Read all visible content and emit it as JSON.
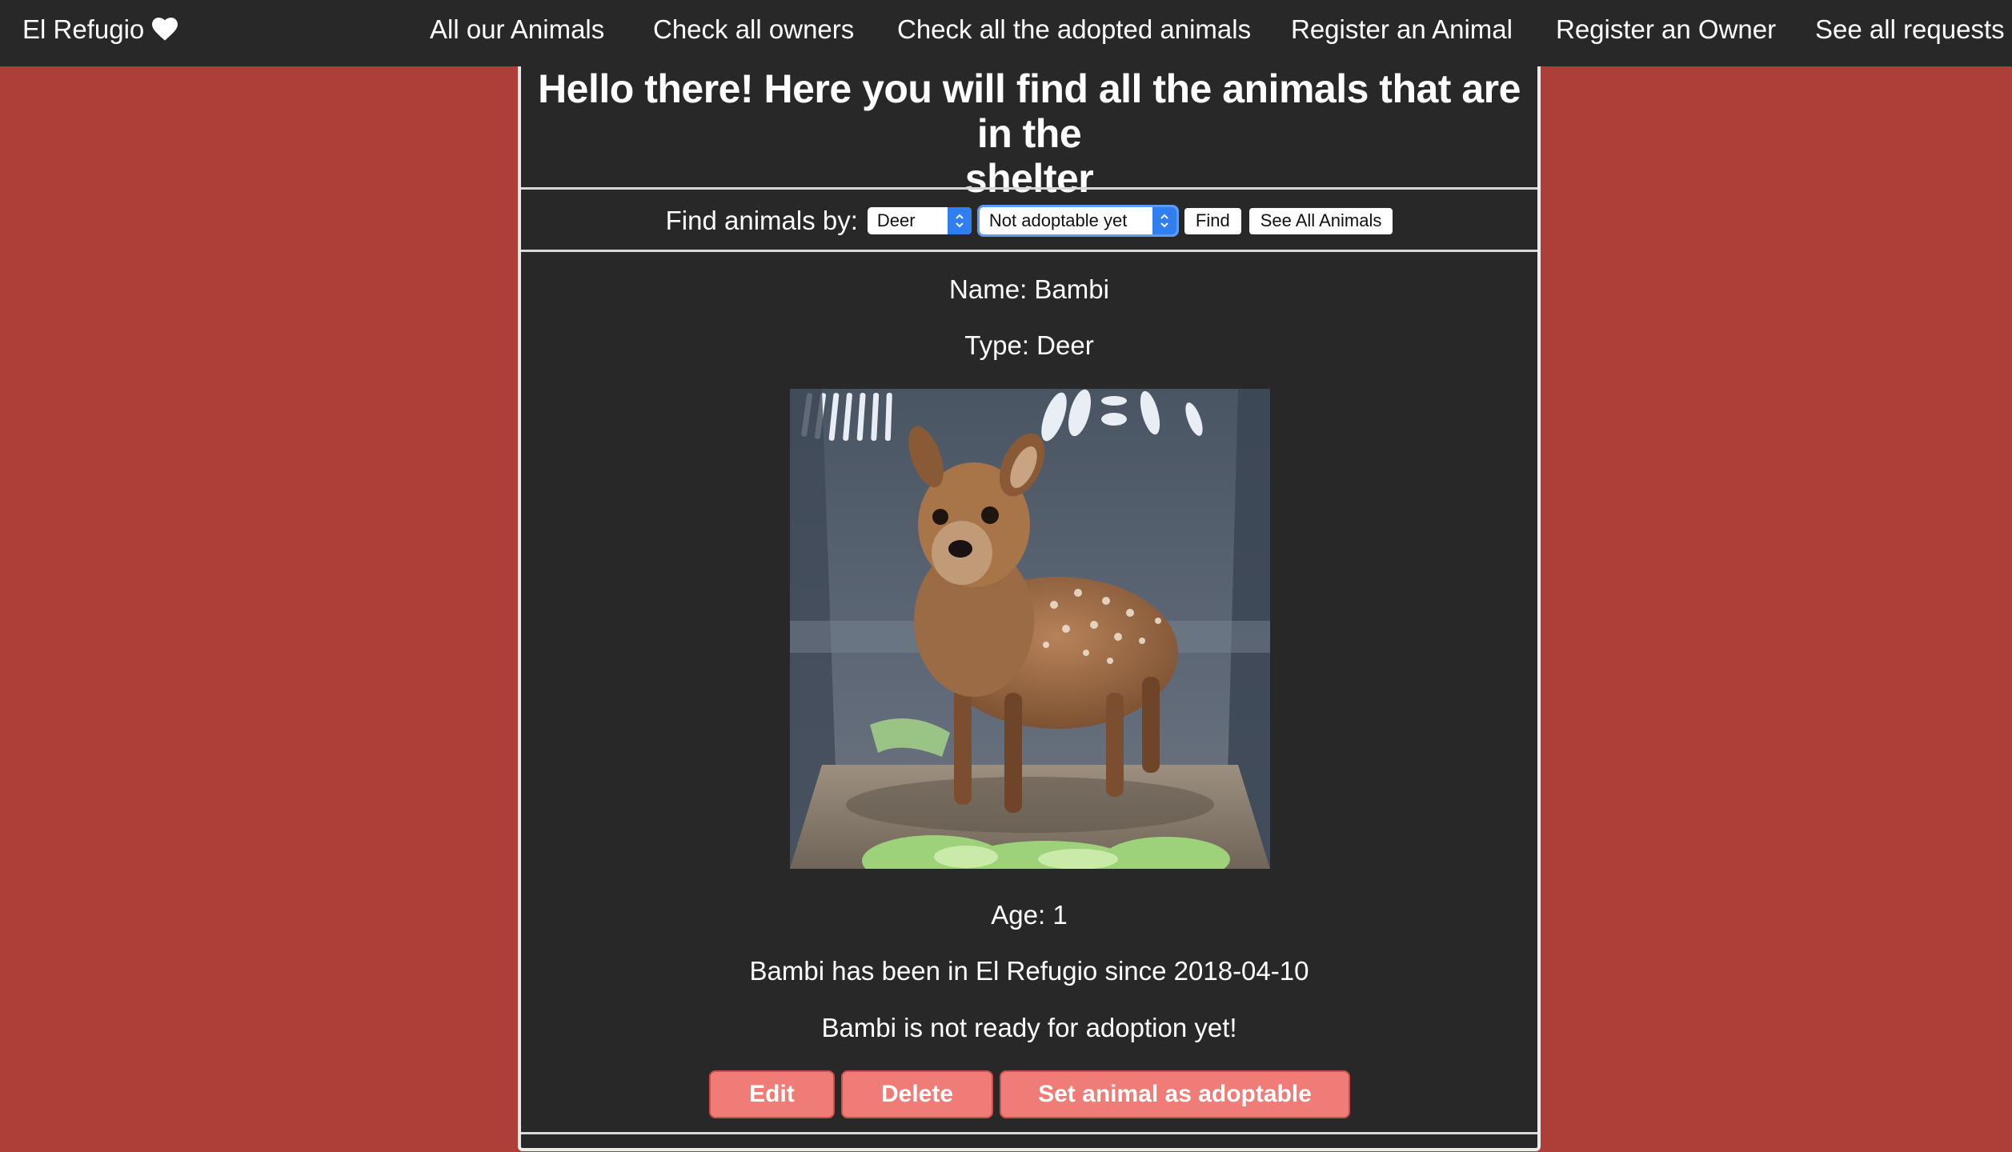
{
  "nav": {
    "brand": "El Refugio",
    "links": [
      "All our Animals",
      "Check all owners",
      "Check all the adopted animals",
      "Register an Animal",
      "Register an Owner",
      "See all requests"
    ]
  },
  "page": {
    "heading_line1": "Hello there! Here you will find all the animals that are in the",
    "heading_line2": "shelter"
  },
  "filter": {
    "label": "Find animals by:",
    "type_selected": "Deer",
    "status_selected": "Not adoptable yet",
    "find_label": "Find",
    "see_all_label": "See All Animals"
  },
  "animal": {
    "name_line": "Name: Bambi",
    "type_line": "Type: Deer",
    "age_line": "Age: 1",
    "since_line": "Bambi has been in El Refugio since 2018-04-10",
    "status_line": "Bambi is not ready for adoption yet!"
  },
  "actions": {
    "edit_label": "Edit",
    "delete_label": "Delete",
    "set_adoptable_label": "Set animal as adoptable"
  },
  "colors": {
    "background": "#ad3e38",
    "navbar": "#282828",
    "panel": "#282828",
    "button": "#f07c78",
    "select_accent": "#2f7ff1"
  },
  "icons": {
    "brand": "heart-icon",
    "select": "chevron-updown-icon"
  }
}
